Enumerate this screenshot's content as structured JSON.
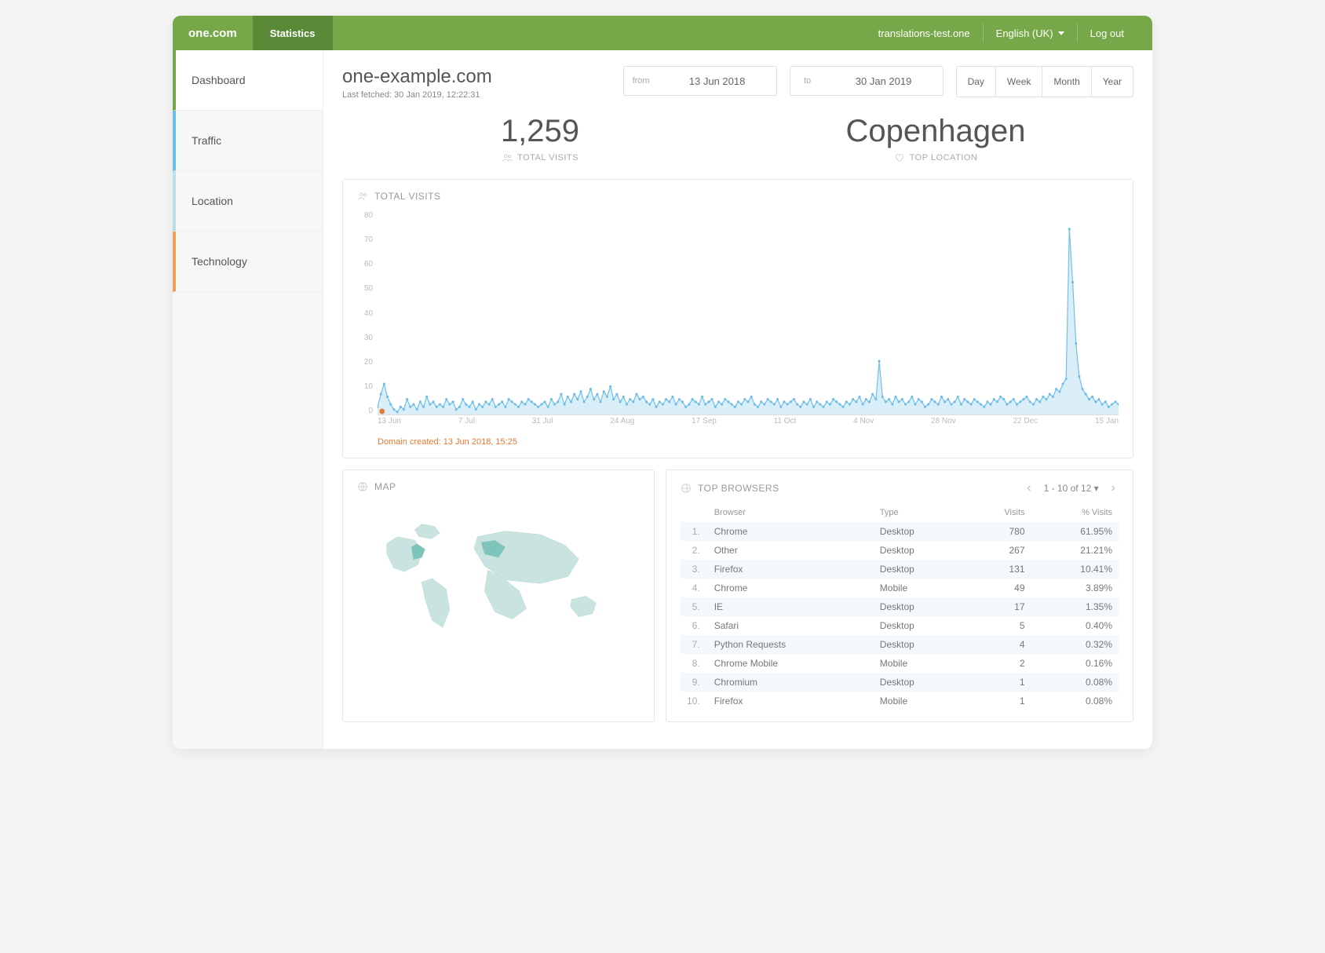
{
  "header": {
    "brand": "one.com",
    "section": "Statistics",
    "account": "translations-test.one",
    "language": "English (UK)",
    "logout": "Log out"
  },
  "sidebar": {
    "items": [
      {
        "label": "Dashboard",
        "cls": "active"
      },
      {
        "label": "Traffic",
        "cls": "traffic"
      },
      {
        "label": "Location",
        "cls": "location"
      },
      {
        "label": "Technology",
        "cls": "technology"
      }
    ]
  },
  "page": {
    "title": "one-example.com",
    "subtitle": "Last fetched: 30 Jan 2019, 12:22:31"
  },
  "daterange": {
    "from_label": "from",
    "from_value": "13 Jun 2018",
    "to_label": "to",
    "to_value": "30 Jan 2019"
  },
  "periods": [
    "Day",
    "Week",
    "Month",
    "Year"
  ],
  "stats": {
    "visits_value": "1,259",
    "visits_label": "TOTAL VISITS",
    "location_value": "Copenhagen",
    "location_label": "TOP LOCATION"
  },
  "chart": {
    "title": "TOTAL VISITS",
    "note": "Domain created: 13 Jun 2018, 15:25"
  },
  "map": {
    "title": "MAP"
  },
  "browsers": {
    "title": "TOP BROWSERS",
    "pager": "1 - 10 of 12",
    "columns": [
      "Browser",
      "Type",
      "Visits",
      "% Visits"
    ],
    "rows": [
      {
        "n": "1.",
        "browser": "Chrome",
        "type": "Desktop",
        "visits": "780",
        "pct": "61.95%"
      },
      {
        "n": "2.",
        "browser": "Other",
        "type": "Desktop",
        "visits": "267",
        "pct": "21.21%"
      },
      {
        "n": "3.",
        "browser": "Firefox",
        "type": "Desktop",
        "visits": "131",
        "pct": "10.41%"
      },
      {
        "n": "4.",
        "browser": "Chrome",
        "type": "Mobile",
        "visits": "49",
        "pct": "3.89%"
      },
      {
        "n": "5.",
        "browser": "IE",
        "type": "Desktop",
        "visits": "17",
        "pct": "1.35%"
      },
      {
        "n": "6.",
        "browser": "Safari",
        "type": "Desktop",
        "visits": "5",
        "pct": "0.40%"
      },
      {
        "n": "7.",
        "browser": "Python Requests",
        "type": "Desktop",
        "visits": "4",
        "pct": "0.32%"
      },
      {
        "n": "8.",
        "browser": "Chrome Mobile",
        "type": "Mobile",
        "visits": "2",
        "pct": "0.16%"
      },
      {
        "n": "9.",
        "browser": "Chromium",
        "type": "Desktop",
        "visits": "1",
        "pct": "0.08%"
      },
      {
        "n": "10.",
        "browser": "Firefox",
        "type": "Mobile",
        "visits": "1",
        "pct": "0.08%"
      }
    ]
  },
  "chart_data": {
    "type": "line",
    "title": "TOTAL VISITS",
    "ylabel": "",
    "ylim": [
      0,
      80
    ],
    "yticks": [
      0,
      10,
      20,
      30,
      40,
      50,
      60,
      70,
      80
    ],
    "x_labels": [
      "13 Jun",
      "7 Jul",
      "31 Jul",
      "24 Aug",
      "17 Sep",
      "11 Oct",
      "4 Nov",
      "28 Nov",
      "22 Dec",
      "15 Jan"
    ],
    "marker": {
      "label": "Domain created: 13 Jun 2018, 15:25",
      "x_index": 0
    },
    "values": [
      3,
      8,
      12,
      7,
      4,
      2,
      1,
      3,
      2,
      6,
      3,
      4,
      2,
      5,
      3,
      7,
      4,
      5,
      3,
      4,
      3,
      6,
      4,
      5,
      2,
      3,
      6,
      4,
      3,
      5,
      2,
      4,
      3,
      5,
      4,
      6,
      3,
      4,
      5,
      3,
      6,
      5,
      4,
      3,
      5,
      4,
      6,
      5,
      4,
      3,
      4,
      5,
      3,
      6,
      4,
      5,
      8,
      4,
      7,
      5,
      8,
      6,
      9,
      5,
      7,
      10,
      6,
      8,
      5,
      9,
      7,
      11,
      6,
      8,
      5,
      7,
      4,
      6,
      5,
      8,
      6,
      7,
      5,
      4,
      6,
      3,
      5,
      4,
      6,
      5,
      7,
      4,
      6,
      5,
      3,
      4,
      6,
      5,
      4,
      7,
      4,
      5,
      6,
      3,
      5,
      4,
      6,
      5,
      4,
      3,
      5,
      4,
      6,
      5,
      7,
      4,
      3,
      5,
      4,
      6,
      5,
      4,
      6,
      3,
      5,
      4,
      5,
      6,
      4,
      3,
      5,
      4,
      6,
      3,
      5,
      4,
      3,
      5,
      4,
      6,
      5,
      4,
      3,
      5,
      4,
      6,
      5,
      7,
      4,
      6,
      5,
      8,
      6,
      21,
      7,
      5,
      6,
      4,
      7,
      5,
      6,
      4,
      5,
      7,
      4,
      6,
      5,
      3,
      4,
      6,
      5,
      4,
      7,
      5,
      6,
      4,
      5,
      7,
      4,
      6,
      5,
      4,
      6,
      5,
      4,
      3,
      5,
      4,
      6,
      5,
      7,
      6,
      4,
      5,
      6,
      4,
      5,
      6,
      7,
      5,
      4,
      6,
      5,
      7,
      6,
      8,
      7,
      10,
      9,
      12,
      14,
      73,
      52,
      28,
      15,
      10,
      8,
      6,
      7,
      5,
      6,
      4,
      5,
      3,
      4,
      5,
      4
    ]
  }
}
